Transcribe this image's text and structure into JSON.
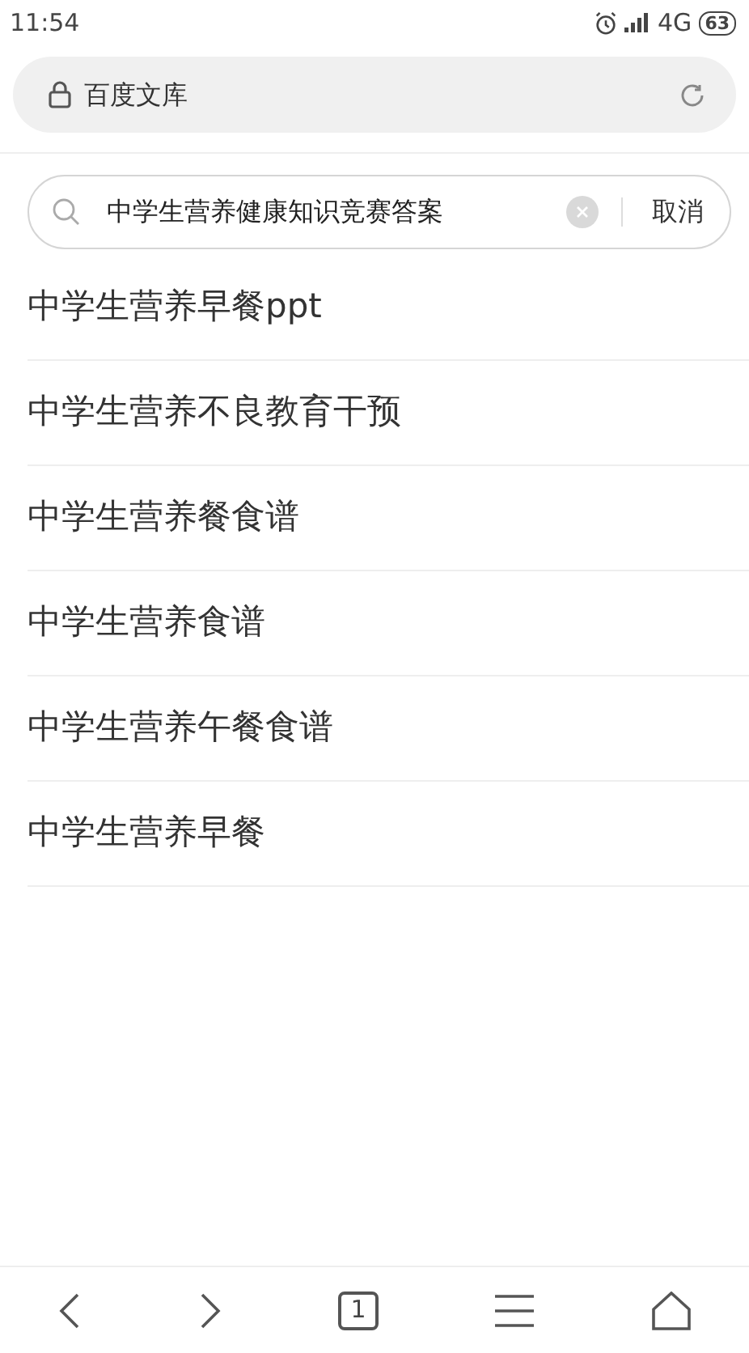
{
  "status_bar": {
    "time": "11:54",
    "network": "4G",
    "battery": "63"
  },
  "address_bar": {
    "title": "百度文库"
  },
  "search": {
    "value": "中学生营养健康知识竞赛答案",
    "cancel": "取消"
  },
  "suggestions": [
    {
      "text": "中学生营养早餐ppt"
    },
    {
      "text": "中学生营养不良教育干预"
    },
    {
      "text": "中学生营养餐食谱"
    },
    {
      "text": "中学生营养食谱"
    },
    {
      "text": "中学生营养午餐食谱"
    },
    {
      "text": "中学生营养早餐"
    }
  ],
  "toolbar": {
    "tab_count": "1"
  }
}
